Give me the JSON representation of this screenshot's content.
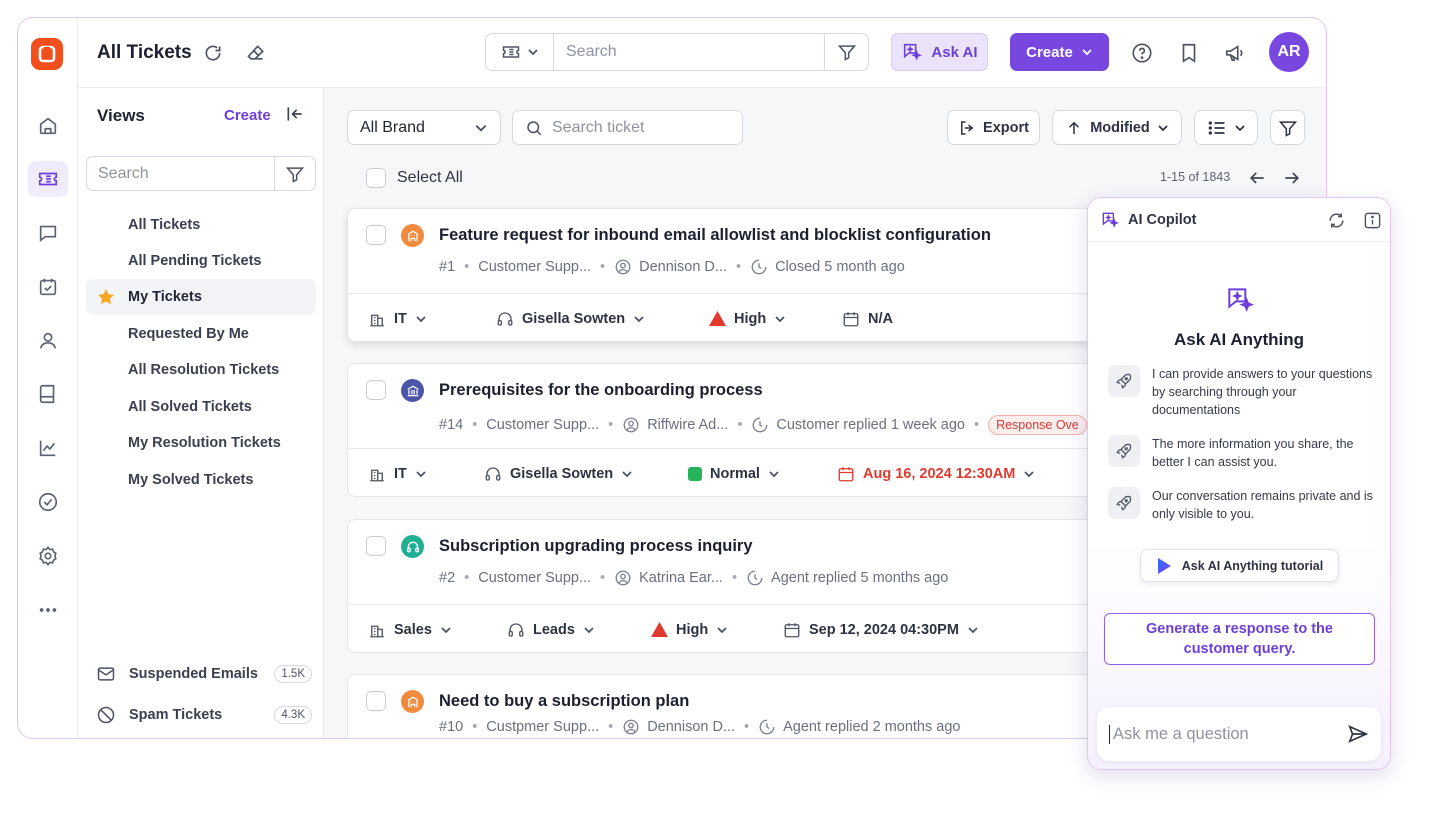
{
  "topbar": {
    "title": "All Tickets",
    "search_placeholder": "Search",
    "ask_ai_label": "Ask AI",
    "create_label": "Create",
    "avatar_initials": "AR"
  },
  "views": {
    "title": "Views",
    "create_label": "Create",
    "search_placeholder": "Search",
    "items": [
      {
        "label": "All Tickets"
      },
      {
        "label": "All Pending Tickets"
      },
      {
        "label": "My Tickets"
      },
      {
        "label": "Requested By Me"
      },
      {
        "label": "All Resolution Tickets"
      },
      {
        "label": "All Solved Tickets"
      },
      {
        "label": "My Resolution Tickets"
      },
      {
        "label": "My Solved Tickets"
      }
    ],
    "footer": [
      {
        "label": "Suspended Emails",
        "count": "1.5K"
      },
      {
        "label": "Spam Tickets",
        "count": "4.3K"
      }
    ]
  },
  "toolbar": {
    "brand": "All Brand",
    "ticket_search_placeholder": "Search ticket",
    "export_label": "Export",
    "sort_label": "Modified",
    "select_all": "Select All",
    "pager": "1-15 of 1843"
  },
  "tickets": [
    {
      "title": "Feature request for inbound email allowlist and blocklist configuration",
      "id": "#1",
      "group": "Customer Supp...",
      "contact": "Dennison D...",
      "status": "Closed 5 month ago",
      "badge": "",
      "dept": "IT",
      "agent": "Gisella Sowten",
      "priority": "High",
      "due": "N/A",
      "icon_color": "#f08a3c"
    },
    {
      "title": "Prerequisites for the onboarding process",
      "id": "#14",
      "group": "Customer Supp...",
      "contact": "Riffwire Ad...",
      "status": "Customer replied 1 week ago",
      "badge": "Response Ove",
      "dept": "IT",
      "agent": "Gisella Sowten",
      "priority": "Normal",
      "due": "Aug 16, 2024 12:30AM",
      "icon_color": "#4a55a8"
    },
    {
      "title": "Subscription upgrading process inquiry",
      "id": "#2",
      "group": "Customer Supp...",
      "contact": "Katrina Ear...",
      "status": "Agent replied 5 months ago",
      "badge": "",
      "dept": "Sales",
      "agent": "Leads",
      "priority": "High",
      "due": "Sep 12, 2024 04:30PM",
      "icon_color": "#1fb093"
    },
    {
      "title": "Need to buy a subscription plan",
      "id": "#10",
      "group": "Custpmer Supp...",
      "contact": "Dennison D...",
      "status": "Agent replied 2 months ago",
      "badge": "",
      "icon_color": "#f08a3c"
    }
  ],
  "copilot": {
    "title": "AI Copilot",
    "heading": "Ask AI Anything",
    "tips": [
      "I can provide answers to your questions by searching through your documentations",
      "The more information you share, the better I can assist you.",
      "Our conversation remains private and is only visible to you."
    ],
    "tutorial_label": "Ask AI Anything tutorial",
    "generate_label": "Generate a response to the customer query.",
    "ask_placeholder": "Ask me a question"
  },
  "colors": {
    "accent": "#7747e0",
    "logo": "#f24f1d",
    "priority_high": "#e03a2f",
    "priority_normal": "#27b25c"
  }
}
